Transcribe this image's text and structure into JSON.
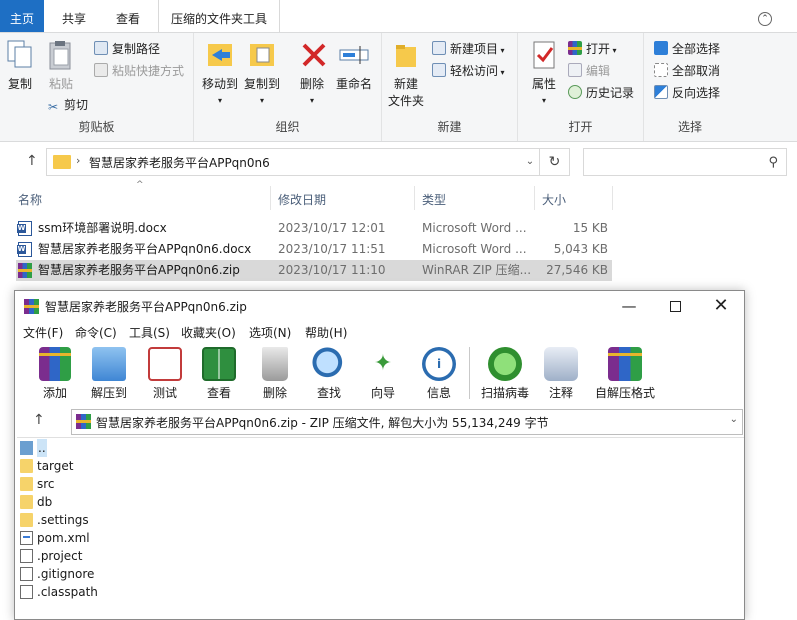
{
  "ribbon": {
    "tabs": [
      "主页",
      "共享",
      "查看",
      "压缩的文件夹工具"
    ],
    "groups": {
      "clipboard": {
        "label": "剪贴板",
        "copy": "复制",
        "paste": "粘贴",
        "copy_path": "复制路径",
        "paste_shortcut": "粘贴快捷方式",
        "cut": "剪切"
      },
      "organize": {
        "label": "组织",
        "move_to": "移动到",
        "copy_to": "复制到",
        "delete": "删除",
        "rename": "重命名"
      },
      "new": {
        "label": "新建",
        "new_folder_line1": "新建",
        "new_folder_line2": "文件夹",
        "new_item": "新建项目",
        "easy_access": "轻松访问"
      },
      "open": {
        "label": "打开",
        "properties": "属性",
        "open": "打开",
        "edit": "编辑",
        "history": "历史记录"
      },
      "select": {
        "label": "选择",
        "select_all": "全部选择",
        "select_none": "全部取消",
        "invert": "反向选择"
      }
    }
  },
  "address": {
    "path": "智慧居家养老服务平台APPqn0n6"
  },
  "file_list": {
    "columns": [
      "名称",
      "修改日期",
      "类型",
      "大小"
    ],
    "rows": [
      {
        "name": "ssm环境部署说明.docx",
        "date": "2023/10/17 12:01",
        "type": "Microsoft Word ...",
        "size": "15 KB",
        "icon": "word-icon"
      },
      {
        "name": "智慧居家养老服务平台APPqn0n6.docx",
        "date": "2023/10/17 11:51",
        "type": "Microsoft Word ...",
        "size": "5,043 KB",
        "icon": "word-icon"
      },
      {
        "name": "智慧居家养老服务平台APPqn0n6.zip",
        "date": "2023/10/17 11:10",
        "type": "WinRAR ZIP 压缩...",
        "size": "27,546 KB",
        "icon": "winrar-icon"
      }
    ]
  },
  "winrar": {
    "title": "智慧居家养老服务平台APPqn0n6.zip",
    "menu": [
      "文件(F)",
      "命令(C)",
      "工具(S)",
      "收藏夹(O)",
      "选项(N)",
      "帮助(H)"
    ],
    "toolbar": [
      "添加",
      "解压到",
      "测试",
      "查看",
      "删除",
      "查找",
      "向导",
      "信息",
      "扫描病毒",
      "注释",
      "自解压格式"
    ],
    "path_text": "智慧居家养老服务平台APPqn0n6.zip - ZIP 压缩文件, 解包大小为 55,134,249 字节",
    "items": [
      {
        "name": "..",
        "kind": "parent"
      },
      {
        "name": "target",
        "kind": "folder"
      },
      {
        "name": "src",
        "kind": "folder"
      },
      {
        "name": "db",
        "kind": "folder"
      },
      {
        "name": ".settings",
        "kind": "folder"
      },
      {
        "name": "pom.xml",
        "kind": "xml"
      },
      {
        "name": ".project",
        "kind": "file"
      },
      {
        "name": ".gitignore",
        "kind": "file"
      },
      {
        "name": ".classpath",
        "kind": "file"
      }
    ]
  },
  "colors": {
    "home_tab": "#1e6fc4",
    "zip_tab_band": "#f8c9ee",
    "selection": "#d9d9d9",
    "folder": "#f6c94b"
  }
}
